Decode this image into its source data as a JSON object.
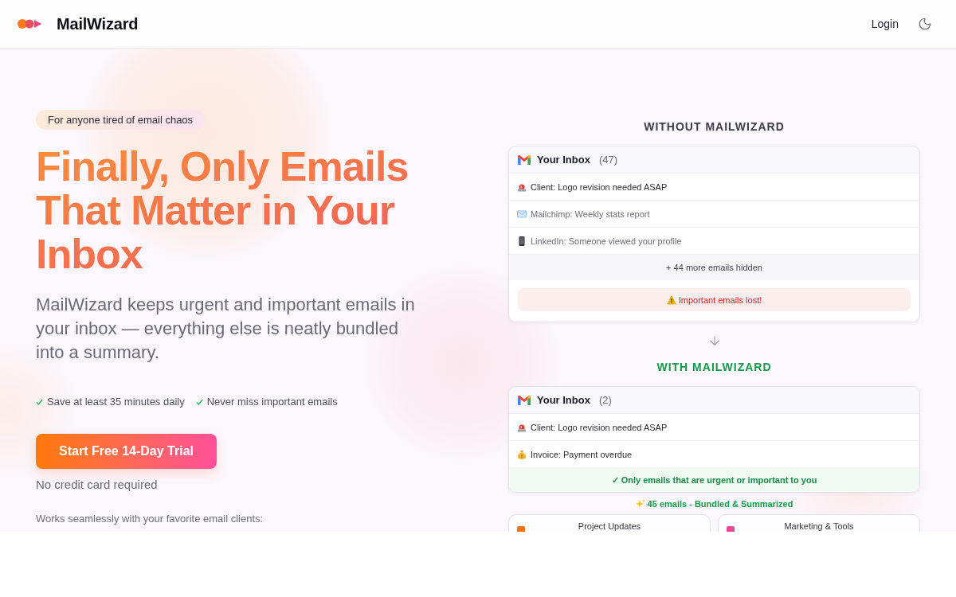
{
  "header": {
    "brand": "MailWizard",
    "login": "Login"
  },
  "hero": {
    "badge": "For anyone tired of email chaos",
    "headline": "Finally, Only Emails That Matter in Your Inbox",
    "subtitle": "MailWizard keeps urgent and important emails in your inbox — everything else is neatly bundled into a summary.",
    "features": [
      "Save at least 35 minutes daily",
      "Never miss important emails"
    ],
    "cta": "Start Free 14-Day Trial",
    "cta_note": "No credit card required",
    "clients_note": "Works seamlessly with your favorite email clients:"
  },
  "without": {
    "heading": "WITHOUT MAILWIZARD",
    "inbox": {
      "title": "Your Inbox",
      "count": "(47)",
      "emails": [
        {
          "kind": "urgent",
          "subject": "Client: Logo revision needed ASAP",
          "important": true
        },
        {
          "kind": "newsletter",
          "subject": "Mailchimp: Weekly stats report",
          "important": false
        },
        {
          "kind": "social",
          "subject": "LinkedIn: Someone viewed your profile",
          "important": false
        }
      ]
    },
    "hidden_note": "+ 44 more emails hidden",
    "alert": "Important emails lost!"
  },
  "with": {
    "heading": "WITH MAILWIZARD",
    "inbox": {
      "title": "Your Inbox",
      "count": "(2)",
      "emails": [
        {
          "kind": "urgent",
          "subject": "Client: Logo revision needed ASAP",
          "important": true
        },
        {
          "kind": "invoice",
          "subject": "Invoice: Payment overdue",
          "important": true
        }
      ]
    },
    "footer": "✓ Only emails that are urgent or important to you",
    "summary": "45 emails - Bundled & Summarized",
    "bundles": [
      {
        "title": "Project Updates",
        "color": "#f97316"
      },
      {
        "title": "Marketing & Tools",
        "color": "#ec4899"
      }
    ]
  }
}
